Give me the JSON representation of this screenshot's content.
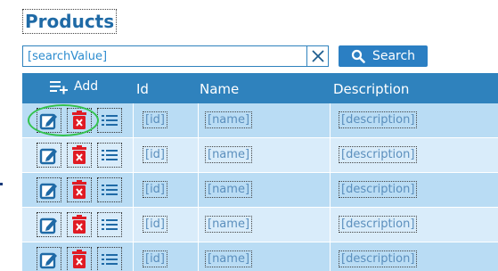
{
  "page": {
    "title": "Products"
  },
  "search": {
    "value": "[searchValue]",
    "button_label": "Search"
  },
  "grid": {
    "add_label": "Add",
    "columns": {
      "id": "Id",
      "name": "Name",
      "description": "Description"
    },
    "rows": [
      {
        "id": "[id]",
        "name": "[name]",
        "description": "[description]"
      },
      {
        "id": "[id]",
        "name": "[name]",
        "description": "[description]"
      },
      {
        "id": "[id]",
        "name": "[name]",
        "description": "[description]"
      },
      {
        "id": "[id]",
        "name": "[name]",
        "description": "[description]"
      },
      {
        "id": "[id]",
        "name": "[name]",
        "description": "[description]"
      }
    ]
  },
  "icons": {
    "edit": "edit-icon",
    "delete": "delete-icon",
    "details": "list-icon",
    "search": "search-icon",
    "clear": "close-icon",
    "add": "playlist-add-icon"
  },
  "colors": {
    "accent": "#2b7fc3",
    "header": "#2f82bd",
    "row_odd": "#b9dcf4",
    "row_even": "#d9ecfa",
    "delete": "#e01b24",
    "highlight": "#33c24d"
  }
}
